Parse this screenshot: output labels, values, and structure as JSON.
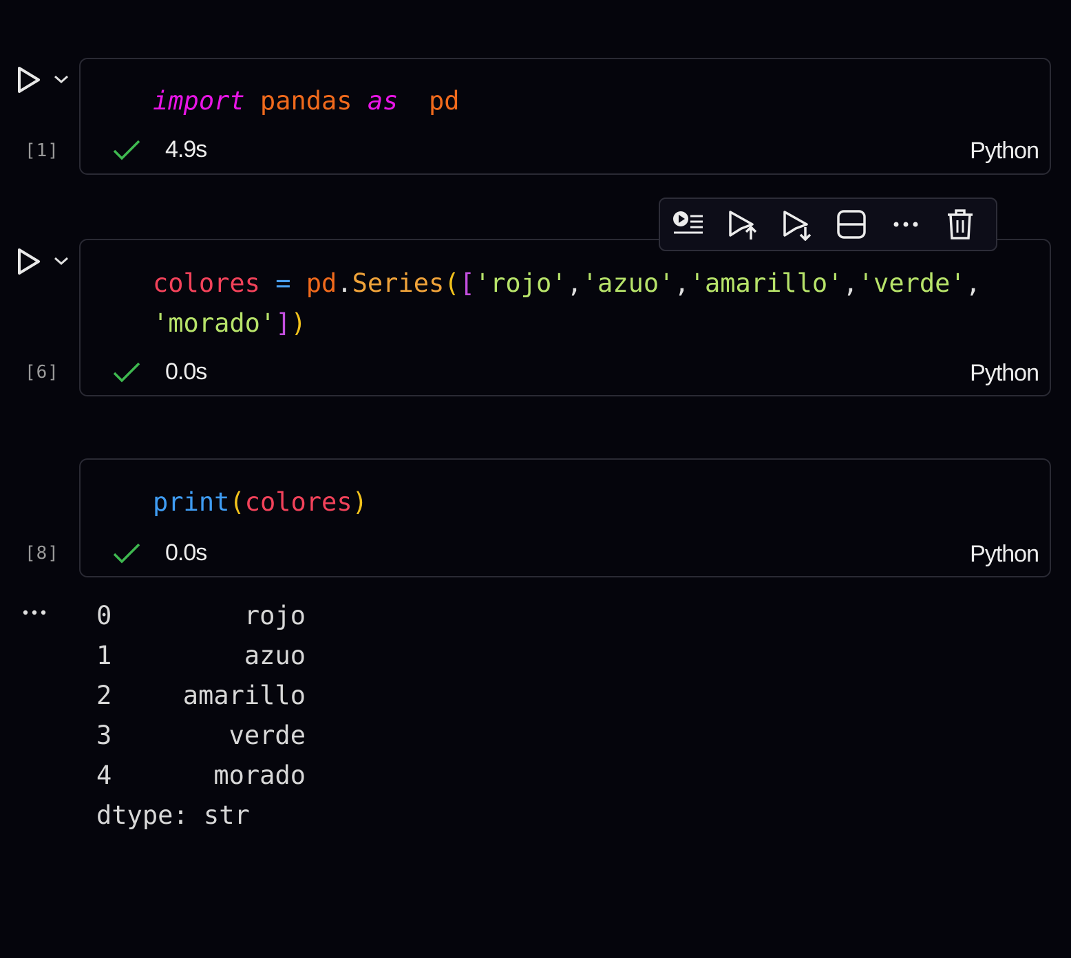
{
  "cells": [
    {
      "exec_count": "[1]",
      "code_tokens": [
        "import",
        " pandas ",
        "as",
        "  pd"
      ],
      "time": "4.9s",
      "language": "Python"
    },
    {
      "exec_count": "[6]",
      "code_line1": [
        "colores",
        " ",
        "=",
        " ",
        "pd",
        ".",
        "Series",
        "(",
        "[",
        "'rojo'",
        ",",
        "'azuo'",
        ",",
        "'amarillo'",
        ",",
        "'verde'",
        ","
      ],
      "code_line2": [
        "'morado'",
        "]",
        ")"
      ],
      "time": "0.0s",
      "language": "Python"
    },
    {
      "exec_count": "[8]",
      "code_tokens": [
        "print",
        "(",
        "colores",
        ")"
      ],
      "time": "0.0s",
      "language": "Python"
    }
  ],
  "output": {
    "rows": [
      {
        "index": "0",
        "value": "rojo"
      },
      {
        "index": "1",
        "value": "azuo"
      },
      {
        "index": "2",
        "value": "amarillo"
      },
      {
        "index": "3",
        "value": "verde"
      },
      {
        "index": "4",
        "value": "morado"
      }
    ],
    "dtype_line": "dtype: str"
  },
  "icons": {
    "run": "play-icon",
    "expand": "chevron-down-icon",
    "success": "check-icon",
    "toolbar": [
      "run-by-line-icon",
      "execute-above-icon",
      "execute-below-icon",
      "split-cell-icon",
      "more-icon",
      "delete-icon"
    ],
    "output_menu": "ellipsis-icon"
  },
  "colors": {
    "background": "#05050c",
    "check": "#3fb950",
    "keyword": "#e815e6",
    "string": "#b7e36a"
  }
}
